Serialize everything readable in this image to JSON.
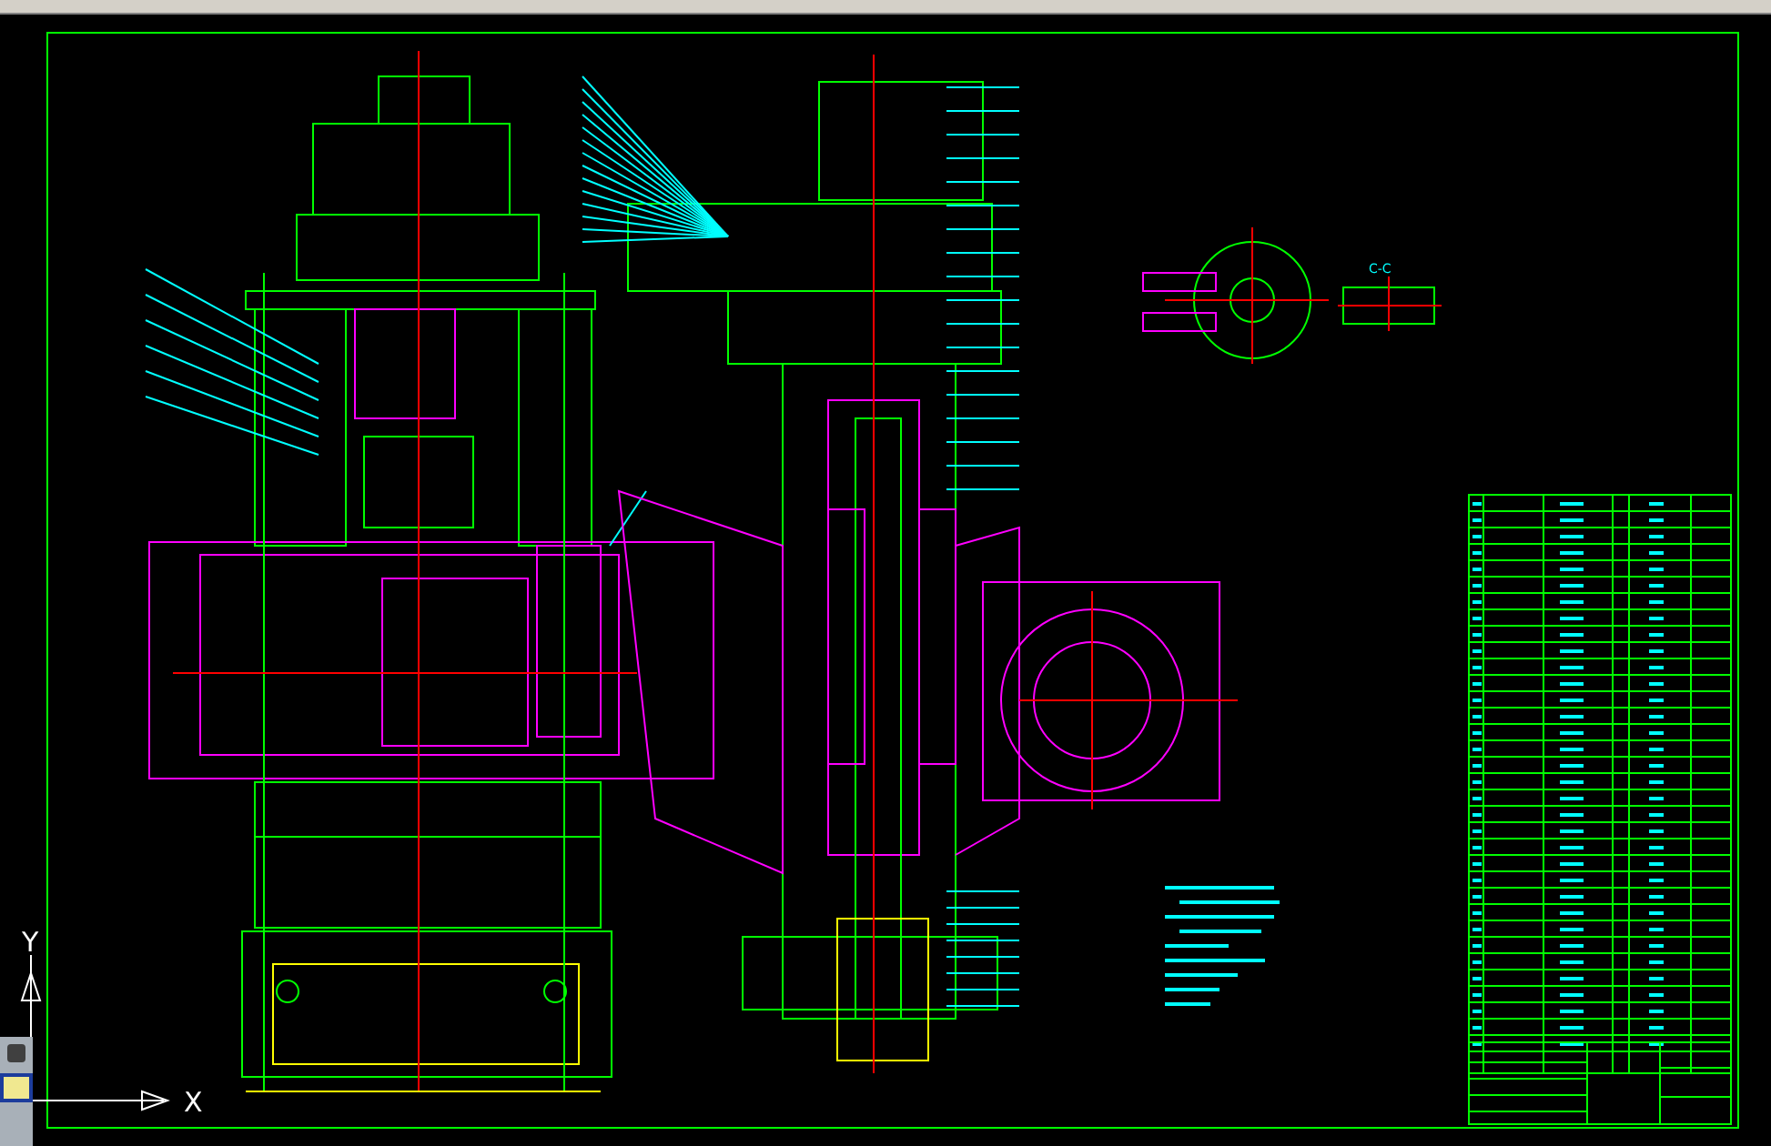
{
  "views": [
    {
      "label": "C-C",
      "kind": "section"
    }
  ],
  "ucs": {
    "x_label": "X",
    "y_label": "Y"
  }
}
